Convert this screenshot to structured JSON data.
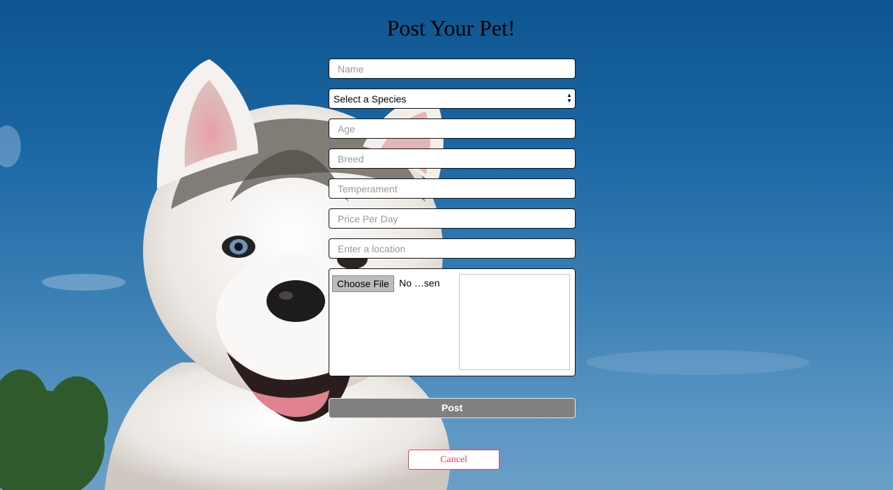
{
  "page": {
    "title": "Post Your Pet!"
  },
  "form": {
    "name_placeholder": "Name",
    "species_selected": "Select a Species",
    "age_placeholder": "Age",
    "breed_placeholder": "Breed",
    "temperament_placeholder": "Temperament",
    "price_placeholder": "Price Per Day",
    "location_placeholder": "Enter a location",
    "file_button_label": "Choose File",
    "file_status": "No …sen",
    "post_label": "Post",
    "cancel_label": "Cancel"
  },
  "colors": {
    "cancel_accent": "#e0415a",
    "post_background": "#808080",
    "sky": "#1b67a3"
  },
  "background": {
    "image_subject": "husky-puppy-photo"
  }
}
